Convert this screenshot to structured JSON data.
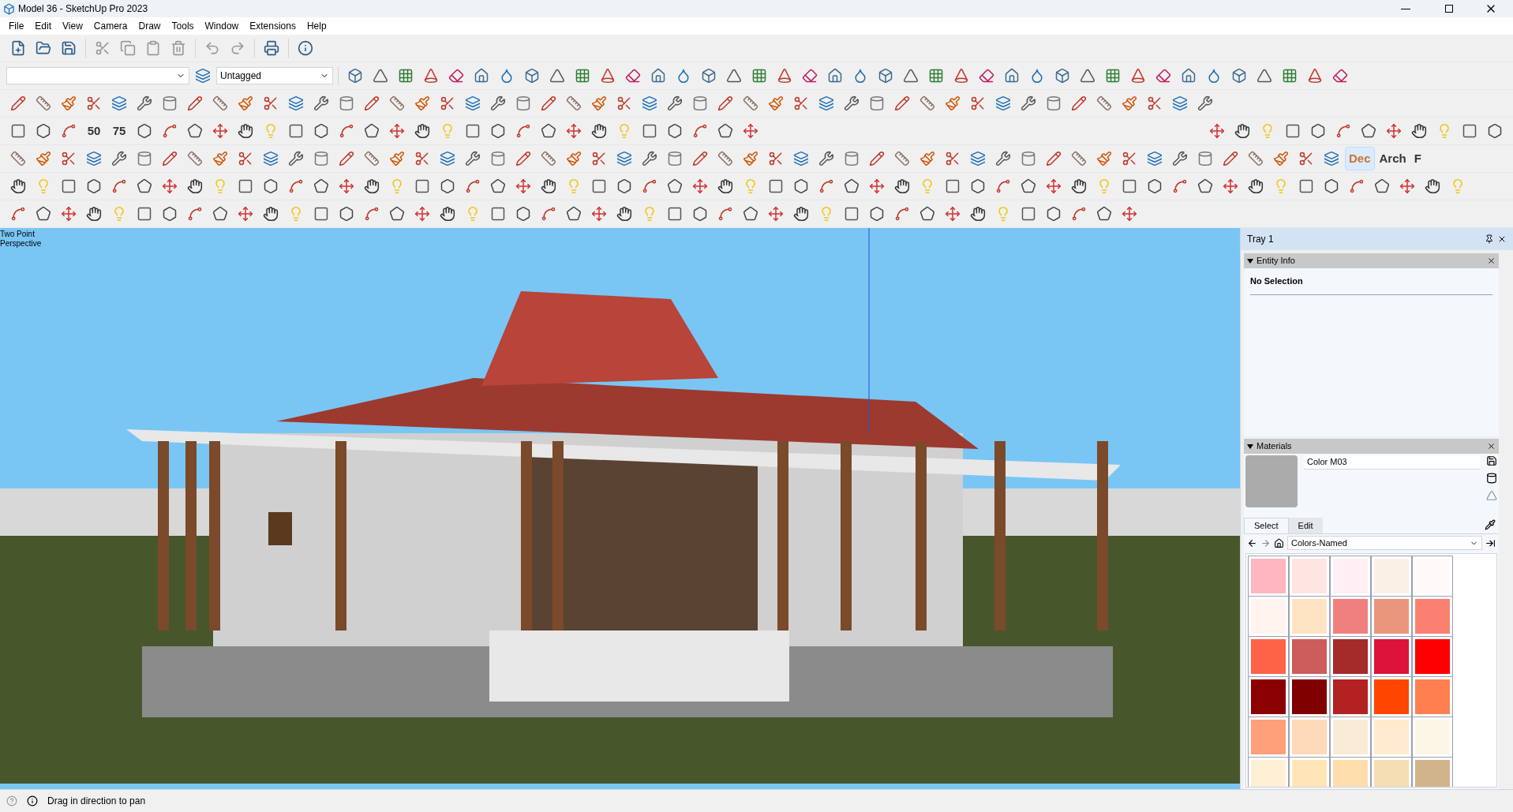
{
  "window": {
    "title": "Model 36 - SketchUp Pro 2023"
  },
  "menu": [
    "File",
    "Edit",
    "View",
    "Camera",
    "Draw",
    "Tools",
    "Window",
    "Extensions",
    "Help"
  ],
  "toolbar": {
    "tag_select": {
      "value": "Untagged"
    },
    "number_buttons": [
      "50",
      "75"
    ],
    "unit_buttons": [
      {
        "label": "Dec",
        "selected": true
      },
      {
        "label": "Arch",
        "selected": false
      },
      {
        "label": "F",
        "selected": false
      }
    ]
  },
  "viewport": {
    "camera_label": [
      "Two Point",
      "Perspective"
    ]
  },
  "tray": {
    "title": "Tray 1",
    "panels": [
      {
        "kind": "entity",
        "title": "Entity Info",
        "expanded": true,
        "heading": "No Selection"
      },
      {
        "kind": "materials",
        "title": "Materials",
        "expanded": true,
        "material_name": "Color M03",
        "color": "#ababab",
        "tabs": [
          {
            "label": "Select",
            "selected": true
          },
          {
            "label": "Edit",
            "selected": false
          }
        ],
        "library": "Colors-Named",
        "colors": [
          {
            "color": "#ffb6c1"
          },
          {
            "color": "#ffe4e1"
          },
          {
            "color": "#fff0f5"
          },
          {
            "color": "#faf0e6"
          },
          {
            "color": "#fffafa"
          },
          {
            "color": "#fff5ee"
          },
          {
            "color": "#ffe4c4"
          },
          {
            "color": "#f08080"
          },
          {
            "color": "#e9967a"
          },
          {
            "color": "#fa8072"
          },
          {
            "color": "#ff6347"
          },
          {
            "color": "#cd5c5c"
          },
          {
            "color": "#a52a2a"
          },
          {
            "color": "#dc143c"
          },
          {
            "color": "#ff0000"
          },
          {
            "color": "#8b0000"
          },
          {
            "color": "#800000"
          },
          {
            "color": "#b22222"
          },
          {
            "color": "#ff4500"
          },
          {
            "color": "#ff7f50"
          },
          {
            "color": "#ffa07a"
          },
          {
            "color": "#ffdab9"
          },
          {
            "color": "#faebd7"
          },
          {
            "color": "#ffebcd"
          },
          {
            "color": "#fdf5e6"
          },
          {
            "color": "#ffefd5"
          },
          {
            "color": "#ffe4b5"
          },
          {
            "color": "#ffdead"
          },
          {
            "color": "#f5deb3"
          },
          {
            "color": "#d2b48c"
          }
        ]
      }
    ]
  },
  "status_bar": {
    "message": "Drag in direction to pan"
  }
}
